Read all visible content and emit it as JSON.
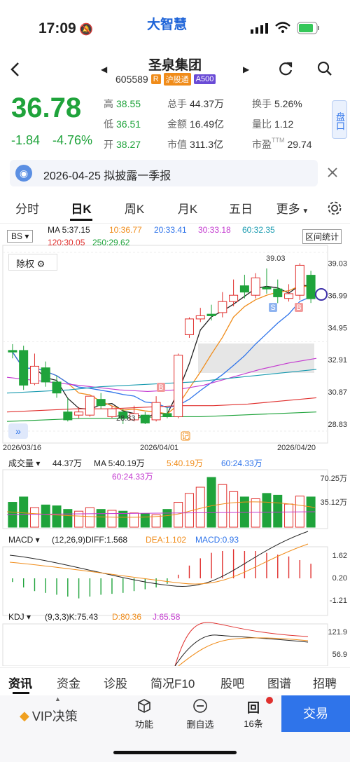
{
  "status": {
    "time": "17:09",
    "logo": "大智慧"
  },
  "header": {
    "name": "圣泉集团",
    "code": "605589",
    "tag_r": "R",
    "tag_hgt": "沪股通",
    "tag_a500": "A500"
  },
  "quote": {
    "price": "36.78",
    "change": "-1.84",
    "pct": "-4.76%",
    "high_l": "高",
    "high": "38.55",
    "low_l": "低",
    "low": "36.51",
    "open_l": "开",
    "open": "38.27",
    "vol_l": "总手",
    "vol": "44.37万",
    "amt_l": "金额",
    "amt": "16.49亿",
    "mcap_l": "市值",
    "mcap": "311.3亿",
    "turn_l": "换手",
    "turn": "5.26%",
    "vr_l": "量比",
    "vr": "1.12",
    "pe_l": "市盈",
    "pe_tag": "TTM",
    "pe": "29.74",
    "side_label": "盘口"
  },
  "notice": {
    "text": "2026-04-25 拟披露一季报"
  },
  "tabs": [
    "分时",
    "日K",
    "周K",
    "月K",
    "五日",
    "更多"
  ],
  "kline": {
    "bs": "BS",
    "ma_label": "MA 5:37.15",
    "ma10": "10:36.77",
    "ma20": "20:33.41",
    "ma30": "30:33.18",
    "ma60": "60:32.35",
    "ma120": "120:30.05",
    "ma250": "250:29.62",
    "interval_btn": "区间统计",
    "fq": "除权",
    "y_ticks": [
      "39.03",
      "36.99",
      "34.95",
      "32.91",
      "30.87",
      "28.83"
    ],
    "x_ticks": [
      "2026/03/16",
      "2026/04/01",
      "2026/04/20"
    ],
    "max_label": "39.03",
    "min_label": "28.83",
    "mark_s": "S",
    "mark_b": "B",
    "mark_ji": "记",
    "colors": {
      "ma5": "#222222",
      "ma10": "#f08c1a",
      "ma20": "#2f74ea",
      "ma30": "#c43bd0",
      "ma60": "#1a9bb0",
      "ma120": "#e0302e",
      "ma250": "#1fa33b"
    }
  },
  "volume": {
    "label": "成交量",
    "val": "44.37万",
    "ma": "MA 5:40.19万",
    "ma5": "5:40.19万",
    "ma60": "60:24.33万",
    "ma60b": "60:24.33万",
    "ticks": [
      "70.25万",
      "35.12万"
    ]
  },
  "macd": {
    "label": "MACD",
    "params": "(12,26,9)DIFF:1.568",
    "dea": "DEA:1.102",
    "macd": "MACD:0.93",
    "ticks": [
      "1.62",
      "0.20",
      "-1.21"
    ]
  },
  "kdj": {
    "label": "KDJ",
    "params": "(9,3,3)K:75.43",
    "d": "D:80.36",
    "j": "J:65.58",
    "ticks": [
      "121.9",
      "56.9"
    ]
  },
  "bottom_tabs": [
    "资讯",
    "资金",
    "诊股",
    "简况F10",
    "股吧",
    "图谱",
    "招聘"
  ],
  "footer": {
    "vip": "VIP决策",
    "func": "功能",
    "del": "删自选",
    "items": "16条",
    "trade": "交易"
  },
  "chart_data": {
    "type": "candlestick",
    "x_range": [
      "2026/03/16",
      "2026/04/20"
    ],
    "ylim": [
      28.83,
      39.03
    ],
    "candles": [
      {
        "o": 33.5,
        "c": 33.4,
        "h": 33.9,
        "l": 33.0
      },
      {
        "o": 33.5,
        "c": 31.3,
        "h": 33.8,
        "l": 31.0
      },
      {
        "o": 31.4,
        "c": 32.5,
        "h": 33.3,
        "l": 31.3
      },
      {
        "o": 32.4,
        "c": 31.5,
        "h": 32.8,
        "l": 31.2
      },
      {
        "o": 31.5,
        "c": 30.8,
        "h": 31.9,
        "l": 30.5
      },
      {
        "o": 29.6,
        "c": 29.1,
        "h": 30.5,
        "l": 29.0
      },
      {
        "o": 29.4,
        "c": 29.6,
        "h": 29.9,
        "l": 29.2
      },
      {
        "o": 29.4,
        "c": 30.6,
        "h": 30.6,
        "l": 29.3
      },
      {
        "o": 30.4,
        "c": 30.0,
        "h": 30.8,
        "l": 29.8
      },
      {
        "o": 29.3,
        "c": 29.8,
        "h": 30.0,
        "l": 29.2
      },
      {
        "o": 29.6,
        "c": 29.2,
        "h": 29.8,
        "l": 28.83
      },
      {
        "o": 29.1,
        "c": 29.5,
        "h": 30.0,
        "l": 29.0
      },
      {
        "o": 29.4,
        "c": 28.9,
        "h": 29.6,
        "l": 28.83
      },
      {
        "o": 29.1,
        "c": 30.2,
        "h": 30.6,
        "l": 29.0
      },
      {
        "o": 29.5,
        "c": 29.3,
        "h": 29.9,
        "l": 29.2
      },
      {
        "o": 29.3,
        "c": 33.2,
        "h": 33.3,
        "l": 29.2
      },
      {
        "o": 34.5,
        "c": 35.5,
        "h": 35.6,
        "l": 34.3
      },
      {
        "o": 35.5,
        "c": 35.7,
        "h": 36.2,
        "l": 35.3
      },
      {
        "o": 35.8,
        "c": 35.7,
        "h": 36.4,
        "l": 35.4
      },
      {
        "o": 35.9,
        "c": 36.6,
        "h": 37.2,
        "l": 35.6
      },
      {
        "o": 36.6,
        "c": 37.0,
        "h": 38.0,
        "l": 36.3
      },
      {
        "o": 37.6,
        "c": 37.2,
        "h": 38.3,
        "l": 36.8
      },
      {
        "o": 37.0,
        "c": 38.1,
        "h": 38.4,
        "l": 36.8
      },
      {
        "o": 37.5,
        "c": 37.4,
        "h": 38.7,
        "l": 37.1
      },
      {
        "o": 37.4,
        "c": 36.9,
        "h": 38.0,
        "l": 36.5
      },
      {
        "o": 36.8,
        "c": 37.1,
        "h": 37.7,
        "l": 36.6
      },
      {
        "o": 37.0,
        "c": 38.9,
        "h": 39.03,
        "l": 36.7
      },
      {
        "o": 38.27,
        "c": 36.78,
        "h": 38.55,
        "l": 36.51
      }
    ]
  }
}
